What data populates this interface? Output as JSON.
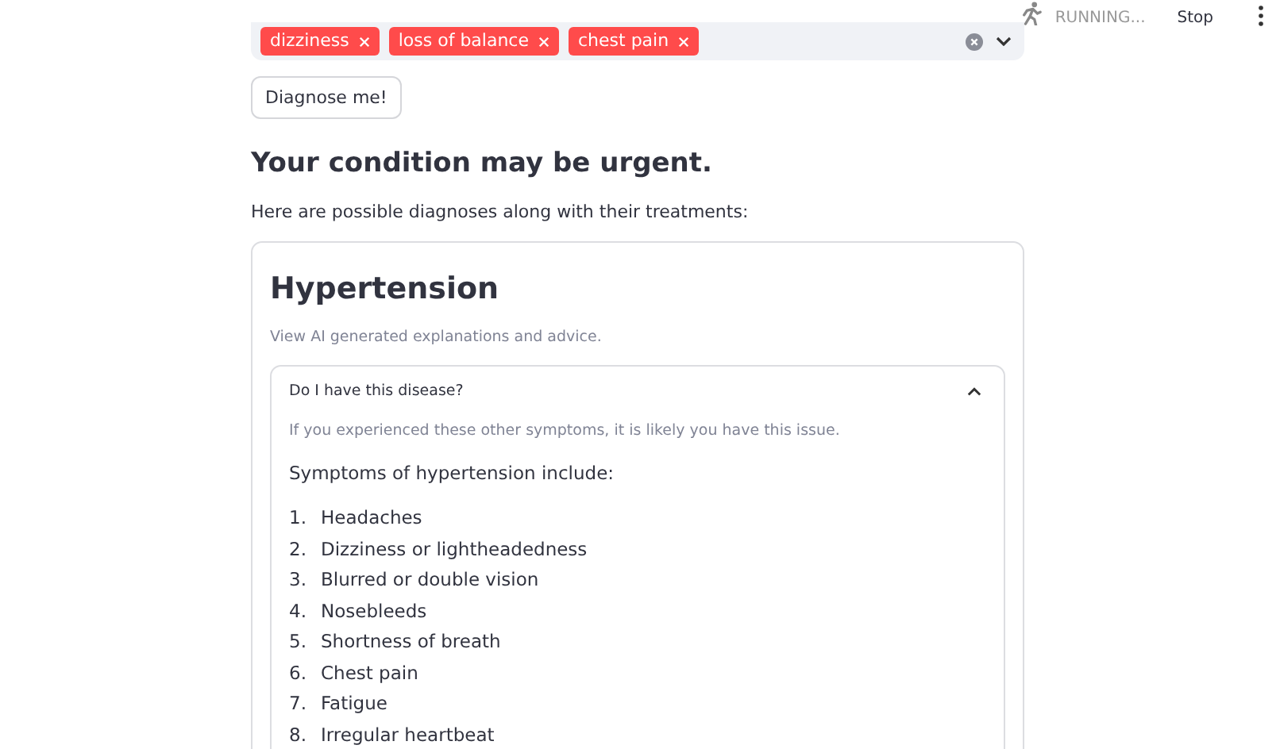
{
  "header": {
    "status": "RUNNING...",
    "stop_label": "Stop"
  },
  "symptoms_select": {
    "tags": [
      {
        "label": "dizziness"
      },
      {
        "label": "loss of balance"
      },
      {
        "label": "chest pain"
      }
    ]
  },
  "diagnose_button": "Diagnose me!",
  "heading": "Your condition may be urgent.",
  "intro": "Here are possible diagnoses along with their treatments:",
  "diagnosis_card": {
    "title": "Hypertension",
    "caption": "View AI generated explanations and advice.",
    "expander": {
      "label": "Do I have this disease?",
      "expanded": true,
      "caption": "If you experienced these other symptoms, it is likely you have this issue.",
      "lead": "Symptoms of hypertension include:",
      "items": [
        {
          "number": "1.",
          "text": "Headaches"
        },
        {
          "number": "2.",
          "text": "Dizziness or lightheadedness"
        },
        {
          "number": "3.",
          "text": "Blurred or double vision"
        },
        {
          "number": "4.",
          "text": "Nosebleeds"
        },
        {
          "number": "5.",
          "text": "Shortness of breath"
        },
        {
          "number": "6.",
          "text": "Chest pain"
        },
        {
          "number": "7.",
          "text": "Fatigue"
        },
        {
          "number": "8.",
          "text": "Irregular heartbeat"
        }
      ]
    }
  }
}
